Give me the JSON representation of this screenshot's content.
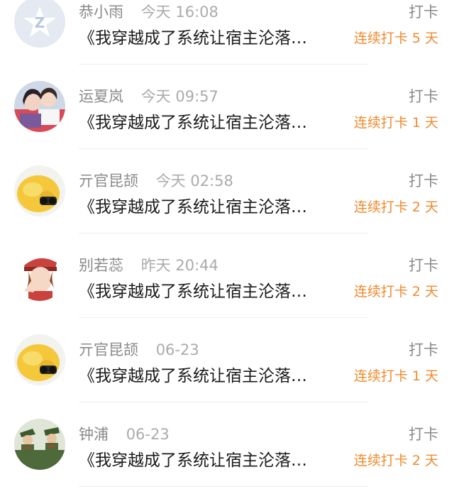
{
  "list": {
    "items": [
      {
        "name": "恭小雨",
        "time": "今天 16:08",
        "action": "打卡",
        "title": "《我穿越成了系统让宿主沦落…",
        "streak": "连续打卡 5 天",
        "avatar_icon": "default-avatar-icon"
      },
      {
        "name": "运夏岚",
        "time": "今天 09:57",
        "action": "打卡",
        "title": "《我穿越成了系统让宿主沦落…",
        "streak": "连续打卡 1 天",
        "avatar_icon": "couple-photo-avatar"
      },
      {
        "name": "亓官昆颉",
        "time": "今天 02:58",
        "action": "打卡",
        "title": "《我穿越成了系统让宿主沦落…",
        "streak": "连续打卡 2 天",
        "avatar_icon": "yellow-chick-avatar"
      },
      {
        "name": "别若蕊",
        "time": "昨天 20:44",
        "action": "打卡",
        "title": "《我穿越成了系统让宿主沦落…",
        "streak": "连续打卡 2 天",
        "avatar_icon": "anime-soldier-avatar"
      },
      {
        "name": "亓官昆颉",
        "time": "06-23",
        "action": "打卡",
        "title": "《我穿越成了系统让宿主沦落…",
        "streak": "连续打卡 1 天",
        "avatar_icon": "yellow-chick-avatar"
      },
      {
        "name": "钟浦",
        "time": "06-23",
        "action": "打卡",
        "title": "《我穿越成了系统让宿主沦落…",
        "streak": "连续打卡 2 天",
        "avatar_icon": "soldiers-avatar"
      }
    ]
  },
  "colors": {
    "accent": "#f08a2c",
    "name": "#8a8a8a",
    "time": "#ababab",
    "title": "#1a1a1a",
    "divider": "#eeeeee"
  }
}
